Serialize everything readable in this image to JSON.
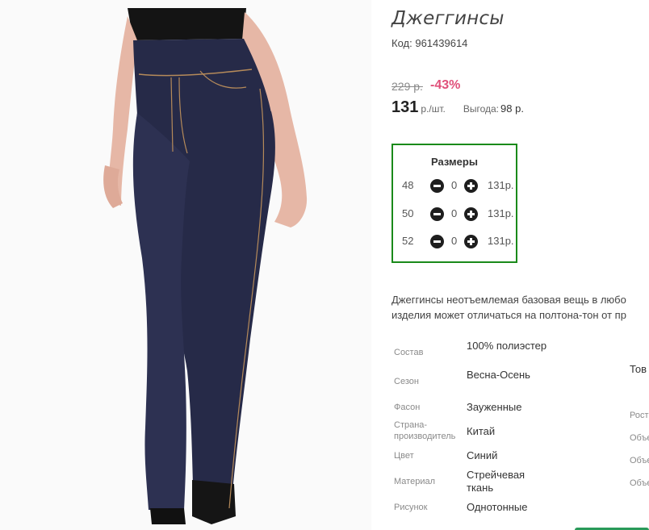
{
  "product": {
    "title": "Джеггинсы",
    "code_label": "Код:",
    "code_value": "961439614",
    "image_icon": "product-photo-jeggings"
  },
  "price": {
    "old": "229 р.",
    "discount": "-43%",
    "current": "131",
    "unit": "р./шт.",
    "savings_label": "Выгода:",
    "savings_value": "98 р."
  },
  "sizes": {
    "header": "Размеры",
    "rows": [
      {
        "size": "48",
        "qty": "0",
        "price": "131р."
      },
      {
        "size": "50",
        "qty": "0",
        "price": "131р."
      },
      {
        "size": "52",
        "qty": "0",
        "price": "131р."
      }
    ]
  },
  "description": {
    "line1": "Джеггинсы неотъемлемая базовая вещь в любо",
    "line2": "изделия может отличаться на полтона-тон от пр"
  },
  "properties": [
    {
      "label": "Состав",
      "value": "100% полиэстер"
    },
    {
      "label": "Сезон",
      "value": "Весна-Осень"
    },
    {
      "label": "Фасон",
      "value": "Зауженные"
    },
    {
      "label": "Страна-производитель",
      "value": "Китай"
    },
    {
      "label": "Цвет",
      "value": "Синий"
    },
    {
      "label": "Материал",
      "value": "Стрейчевая ткань"
    },
    {
      "label": "Рисунок",
      "value": "Однотонные"
    }
  ],
  "clipped_right": {
    "heading": "Тов",
    "labels": [
      "Рост",
      "Объе",
      "Объе",
      "Объе"
    ]
  },
  "colors": {
    "accent_border": "#1a8a1a",
    "discount": "#e0507a",
    "denim": "#262a48"
  }
}
